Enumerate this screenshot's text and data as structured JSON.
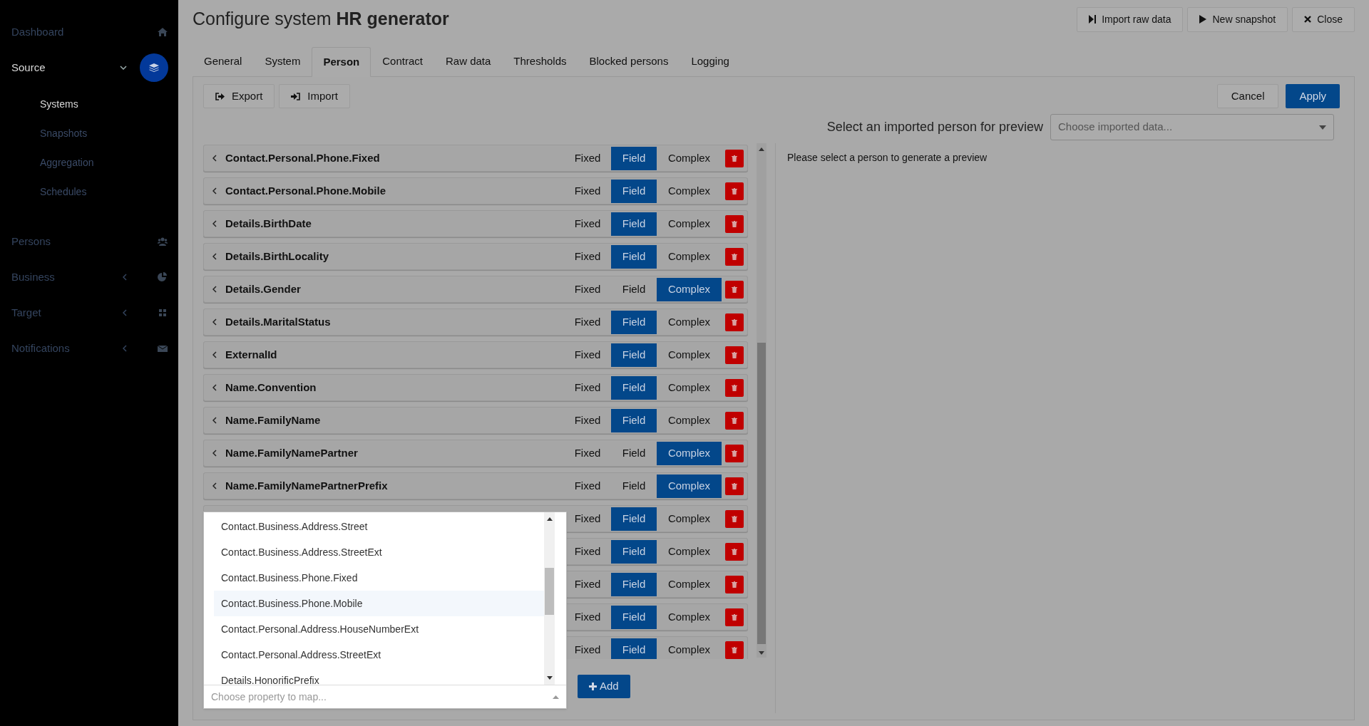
{
  "sidebar": {
    "items": [
      {
        "label": "Dashboard",
        "selected": false
      },
      {
        "label": "Source",
        "expanded": true,
        "selected": true,
        "children": [
          {
            "label": "Systems",
            "selected": true
          },
          {
            "label": "Snapshots",
            "selected": false
          },
          {
            "label": "Aggregation",
            "selected": false
          },
          {
            "label": "Schedules",
            "selected": false
          }
        ]
      },
      {
        "label": "Persons",
        "selected": false
      },
      {
        "label": "Business",
        "expanded": false,
        "selected": false
      },
      {
        "label": "Target",
        "expanded": false,
        "selected": false
      },
      {
        "label": "Notifications",
        "expanded": false,
        "selected": false
      }
    ]
  },
  "header": {
    "title_prefix": "Configure system ",
    "title_name": "HR generator",
    "buttons": [
      {
        "label": "Import raw data"
      },
      {
        "label": "New snapshot"
      },
      {
        "label": "Close"
      }
    ]
  },
  "tabs": [
    {
      "label": "General",
      "selected": false
    },
    {
      "label": "System",
      "selected": false
    },
    {
      "label": "Person",
      "selected": true
    },
    {
      "label": "Contract",
      "selected": false
    },
    {
      "label": "Raw data",
      "selected": false
    },
    {
      "label": "Thresholds",
      "selected": false
    },
    {
      "label": "Blocked persons",
      "selected": false
    },
    {
      "label": "Logging",
      "selected": false
    }
  ],
  "toolbar": {
    "left": [
      {
        "label": "Export"
      },
      {
        "label": "Import"
      }
    ],
    "cancel": "Cancel",
    "apply": "Apply"
  },
  "preview": {
    "label": "Select an imported person for preview",
    "placeholder": "Choose imported data...",
    "message": "Please select a person to generate a preview"
  },
  "mappings": [
    {
      "name": "Contact.Personal.Phone.Fixed",
      "options": [
        {
          "label": "Fixed",
          "selected": false
        },
        {
          "label": "Field",
          "selected": true
        },
        {
          "label": "Complex",
          "selected": false
        }
      ]
    },
    {
      "name": "Contact.Personal.Phone.Mobile",
      "options": [
        {
          "label": "Fixed",
          "selected": false
        },
        {
          "label": "Field",
          "selected": true
        },
        {
          "label": "Complex",
          "selected": false
        }
      ]
    },
    {
      "name": "Details.BirthDate",
      "options": [
        {
          "label": "Fixed",
          "selected": false
        },
        {
          "label": "Field",
          "selected": true
        },
        {
          "label": "Complex",
          "selected": false
        }
      ]
    },
    {
      "name": "Details.BirthLocality",
      "options": [
        {
          "label": "Fixed",
          "selected": false
        },
        {
          "label": "Field",
          "selected": true
        },
        {
          "label": "Complex",
          "selected": false
        }
      ]
    },
    {
      "name": "Details.Gender",
      "options": [
        {
          "label": "Fixed",
          "selected": false
        },
        {
          "label": "Field",
          "selected": false
        },
        {
          "label": "Complex",
          "selected": true
        }
      ]
    },
    {
      "name": "Details.MaritalStatus",
      "options": [
        {
          "label": "Fixed",
          "selected": false
        },
        {
          "label": "Field",
          "selected": true
        },
        {
          "label": "Complex",
          "selected": false
        }
      ]
    },
    {
      "name": "ExternalId",
      "options": [
        {
          "label": "Fixed",
          "selected": false
        },
        {
          "label": "Field",
          "selected": true
        },
        {
          "label": "Complex",
          "selected": false
        }
      ]
    },
    {
      "name": "Name.Convention",
      "options": [
        {
          "label": "Fixed",
          "selected": false
        },
        {
          "label": "Field",
          "selected": true
        },
        {
          "label": "Complex",
          "selected": false
        }
      ]
    },
    {
      "name": "Name.FamilyName",
      "options": [
        {
          "label": "Fixed",
          "selected": false
        },
        {
          "label": "Field",
          "selected": true
        },
        {
          "label": "Complex",
          "selected": false
        }
      ]
    },
    {
      "name": "Name.FamilyNamePartner",
      "options": [
        {
          "label": "Fixed",
          "selected": false
        },
        {
          "label": "Field",
          "selected": false
        },
        {
          "label": "Complex",
          "selected": true
        }
      ]
    },
    {
      "name": "Name.FamilyNamePartnerPrefix",
      "options": [
        {
          "label": "Fixed",
          "selected": false
        },
        {
          "label": "Field",
          "selected": false
        },
        {
          "label": "Complex",
          "selected": true
        }
      ]
    },
    {
      "options": [
        {
          "label": "Fixed",
          "selected": false
        },
        {
          "label": "Field",
          "selected": true
        },
        {
          "label": "Complex",
          "selected": false
        }
      ]
    },
    {
      "options": [
        {
          "label": "Fixed",
          "selected": false
        },
        {
          "label": "Field",
          "selected": true
        },
        {
          "label": "Complex",
          "selected": false
        }
      ]
    },
    {
      "options": [
        {
          "label": "Fixed",
          "selected": false
        },
        {
          "label": "Field",
          "selected": true
        },
        {
          "label": "Complex",
          "selected": false
        }
      ]
    },
    {
      "options": [
        {
          "label": "Fixed",
          "selected": false
        },
        {
          "label": "Field",
          "selected": true
        },
        {
          "label": "Complex",
          "selected": false
        }
      ]
    },
    {
      "options": [
        {
          "label": "Fixed",
          "selected": false
        },
        {
          "label": "Field",
          "selected": true
        },
        {
          "label": "Complex",
          "selected": false
        }
      ]
    }
  ],
  "property_dropdown": {
    "placeholder": "Choose property to map...",
    "options": [
      {
        "label": "Contact.Business.Address.Street",
        "highlighted": false
      },
      {
        "label": "Contact.Business.Address.StreetExt",
        "highlighted": false
      },
      {
        "label": "Contact.Business.Phone.Fixed",
        "highlighted": false
      },
      {
        "label": "Contact.Business.Phone.Mobile",
        "highlighted": true
      },
      {
        "label": "Contact.Personal.Address.HouseNumberExt",
        "highlighted": false
      },
      {
        "label": "Contact.Personal.Address.StreetExt",
        "highlighted": false
      },
      {
        "label": "Details.HonorificPrefix",
        "highlighted": false
      }
    ]
  },
  "add_button": {
    "label": "Add"
  }
}
